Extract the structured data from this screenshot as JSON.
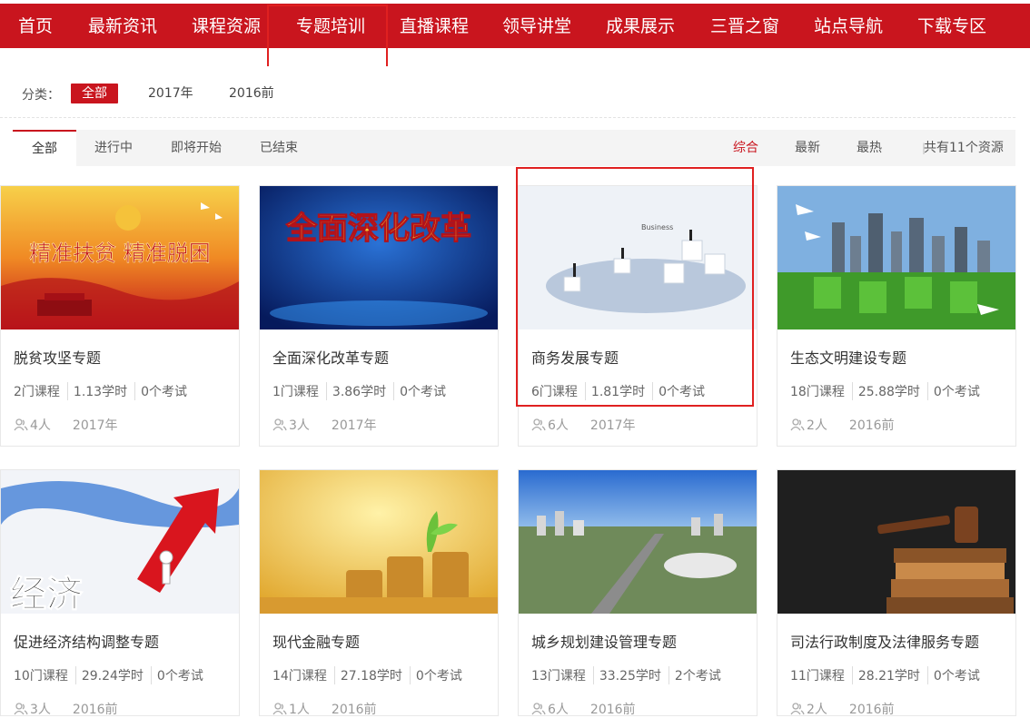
{
  "nav": {
    "items": [
      "首页",
      "最新资讯",
      "课程资源",
      "专题培训",
      "直播课程",
      "领导讲堂",
      "成果展示",
      "三晋之窗",
      "站点导航",
      "下载专区"
    ],
    "active_index": 3
  },
  "filter": {
    "label": "分类：",
    "chips": [
      "全部",
      "2017年",
      "2016前"
    ],
    "active_index": 0
  },
  "tabs": {
    "items": [
      "全部",
      "进行中",
      "即将开始",
      "已结束"
    ],
    "active_index": 0
  },
  "sort": {
    "items": [
      "综合",
      "最新",
      "最热"
    ],
    "active_index": 0,
    "total_text": "共有11个资源"
  },
  "cards": [
    {
      "title": "脱贫攻坚专题",
      "courses": "2门课程",
      "hours": "1.13学时",
      "exams": "0个考试",
      "people": "4人",
      "year": "2017年",
      "thumb_text": "精准扶贫  精准脱困"
    },
    {
      "title": "全面深化改革专题",
      "courses": "1门课程",
      "hours": "3.86学时",
      "exams": "0个考试",
      "people": "3人",
      "year": "2017年",
      "thumb_text": "全面深化改革"
    },
    {
      "title": "商务发展专题",
      "courses": "6门课程",
      "hours": "1.81学时",
      "exams": "0个考试",
      "people": "6人",
      "year": "2017年",
      "thumb_text": "Business"
    },
    {
      "title": "生态文明建设专题",
      "courses": "18门课程",
      "hours": "25.88学时",
      "exams": "0个考试",
      "people": "2人",
      "year": "2016前",
      "thumb_text": ""
    },
    {
      "title": "促进经济结构调整专题",
      "courses": "10门课程",
      "hours": "29.24学时",
      "exams": "0个考试",
      "people": "3人",
      "year": "2016前",
      "thumb_text": "经济"
    },
    {
      "title": "现代金融专题",
      "courses": "14门课程",
      "hours": "27.18学时",
      "exams": "0个考试",
      "people": "1人",
      "year": "2016前",
      "thumb_text": ""
    },
    {
      "title": "城乡规划建设管理专题",
      "courses": "13门课程",
      "hours": "33.25学时",
      "exams": "2个考试",
      "people": "6人",
      "year": "2016前",
      "thumb_text": ""
    },
    {
      "title": "司法行政制度及法律服务专题",
      "courses": "11门课程",
      "hours": "28.21学时",
      "exams": "0个考试",
      "people": "2人",
      "year": "2016前",
      "thumb_text": ""
    }
  ],
  "colors": {
    "brand_red": "#c9151e",
    "highlight": "#e02020"
  }
}
